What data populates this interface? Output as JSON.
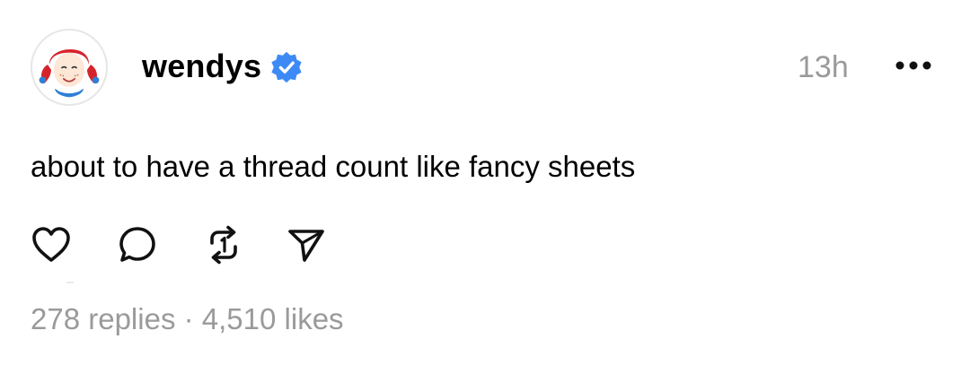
{
  "post": {
    "username": "wendys",
    "time": "13h",
    "text": "about to have a thread count like fancy sheets",
    "stats": {
      "replies": "278 replies",
      "separator": " · ",
      "likes": "4,510 likes"
    }
  },
  "icons": {
    "avatar": "wendys-logo",
    "verified": "verified-badge-icon",
    "more": "more-options-icon",
    "like": "heart-icon",
    "reply": "comment-icon",
    "repost": "repost-icon",
    "share": "send-icon"
  },
  "colors": {
    "verified_blue": "#3d8af7",
    "muted_text": "#9a9a9a",
    "logo_red": "#d6232b"
  }
}
